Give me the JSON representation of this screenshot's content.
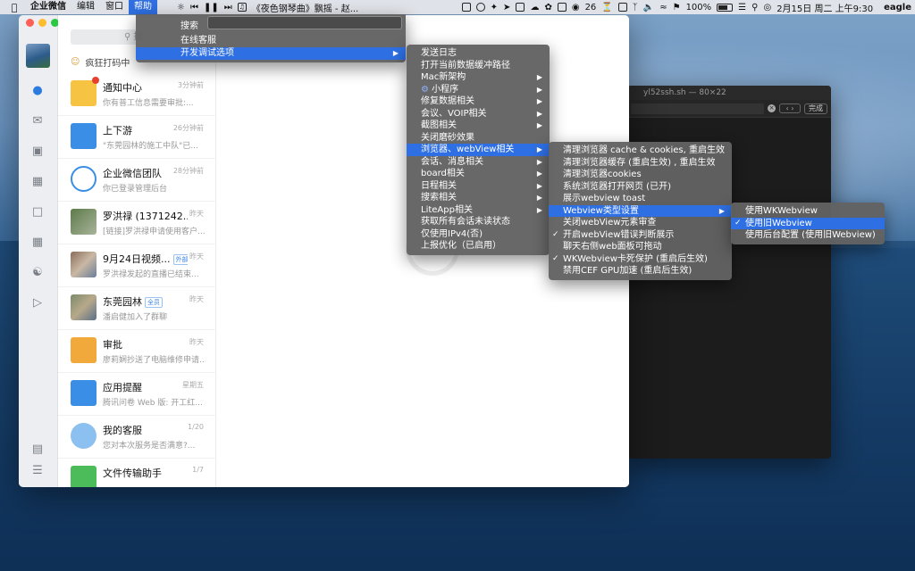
{
  "menubar": {
    "app_name": "企业微信",
    "items": [
      "编辑",
      "窗口",
      "帮助"
    ],
    "song": "《夜色钢琴曲》飘摇 - 赵...",
    "notification_count": "26",
    "battery": "100%",
    "datetime": "2月15日 周二 上午9:30",
    "user": "eagle"
  },
  "help_menu": {
    "search_label": "搜索",
    "items": [
      "在线客服",
      "开发调试选项"
    ]
  },
  "dev_menu": {
    "items": [
      "发送日志",
      "打开当前数据缓冲路径",
      "Mac新架构",
      "小程序",
      "修复数据相关",
      "会议、VOIP相关",
      "截图相关",
      "关闭磨砂效果",
      "浏览器、webView相关",
      "会话、消息相关",
      "board相关",
      "日程相关",
      "搜索相关",
      "LiteApp相关",
      "获取所有会话未读状态",
      "仅使用IPv4(否)",
      "上报优化（已启用）"
    ]
  },
  "browser_menu": {
    "items": [
      "清理浏览器 cache & cookies, 重启生效",
      "清理浏览器缓存 (重启生效) , 重启生效",
      "清理浏览器cookies",
      "系统浏览器打开网页 (已开)",
      "展示webview toast",
      "Webview类型设置",
      "关闭webView元素审查",
      "开启webView错误判断展示",
      "聊天右侧web面板可拖动",
      "WKWebview卡死保护 (重启后生效)",
      "禁用CEF GPU加速 (重启后生效)"
    ]
  },
  "webview_menu": {
    "items": [
      "使用WKWebview",
      "使用旧Webview",
      "使用后台配置 (使用旧Webview)"
    ]
  },
  "terminal": {
    "title": "yl52ssh.sh — 80×22",
    "done_label": "完成"
  },
  "sidebar": {
    "search_placeholder": "搜",
    "pinned_label": "疯狂打码中"
  },
  "chats": [
    {
      "name": "通知中心",
      "time": "3分钟前",
      "preview": "你有普工信息需要审批:..."
    },
    {
      "name": "上下游",
      "time": "26分钟前",
      "preview": "\"东莞园林的施工中队\"已..."
    },
    {
      "name": "企业微信团队",
      "time": "28分钟前",
      "preview": "你已登录管理后台"
    },
    {
      "name": "罗洪禄 (1371242...",
      "time": "昨天",
      "preview": "[链接]罗洪禄申请使用客户..."
    },
    {
      "name": "9月24日视频...",
      "tag": "外部",
      "time": "昨天",
      "preview": "罗洪禄发起的直播已结束..."
    },
    {
      "name": "东莞园林",
      "tag": "全员",
      "time": "昨天",
      "preview": "潘启健加入了群聊"
    },
    {
      "name": "审批",
      "time": "昨天",
      "preview": "廖莉娴抄送了电脑维修申请..."
    },
    {
      "name": "应用提醒",
      "time": "星期五",
      "preview": "腾讯问卷 Web 版: 开工红..."
    },
    {
      "name": "我的客服",
      "time": "1/20",
      "preview": "您对本次服务是否满意?..."
    },
    {
      "name": "文件传输助手",
      "time": "1/7",
      "preview": ""
    }
  ],
  "colors": {
    "accent": "#2e6fe3",
    "menu_bg": "#626262",
    "badge": "#e8402f"
  }
}
